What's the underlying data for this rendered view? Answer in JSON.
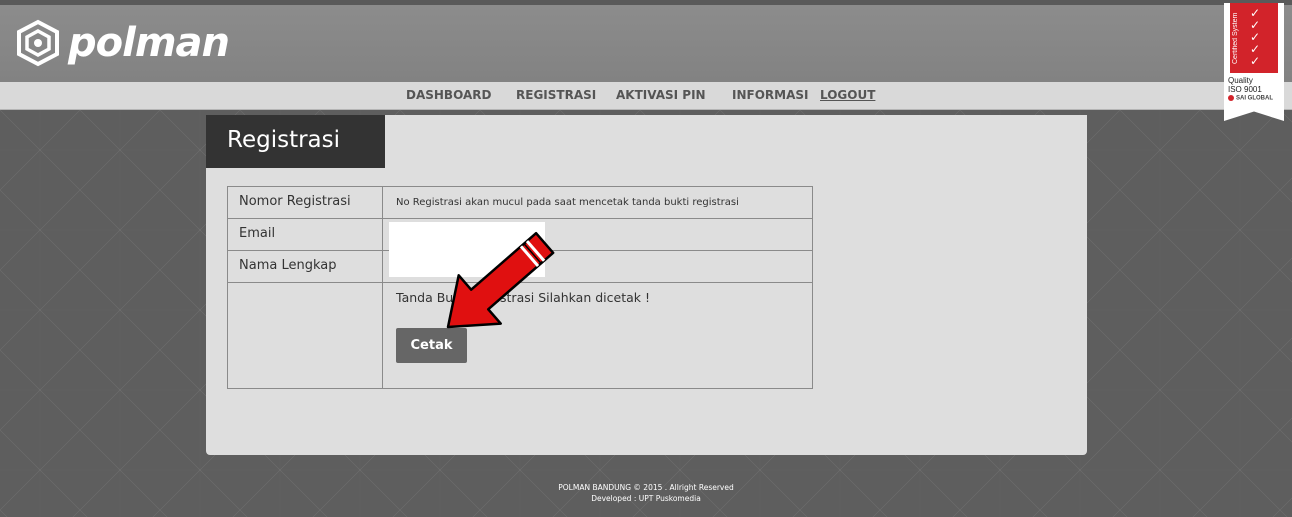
{
  "brand": {
    "logo_text": "polman",
    "logo_icon": "polman-hex-icon"
  },
  "nav": {
    "items": [
      {
        "label": "DASHBOARD"
      },
      {
        "label": "REGISTRASI"
      },
      {
        "label": "AKTIVASI PIN"
      },
      {
        "label": "INFORMASI"
      },
      {
        "label": "LOGOUT"
      }
    ]
  },
  "certification": {
    "vertical_text": "Certified System",
    "line1": "Quality",
    "line2": "ISO 9001",
    "line3": "SAI GLOBAL"
  },
  "page": {
    "title": "Registrasi"
  },
  "form": {
    "rows": [
      {
        "label": "Nomor Registrasi",
        "value": "No Registrasi akan mucul pada saat mencetak tanda bukti registrasi"
      },
      {
        "label": "Email",
        "value": ""
      },
      {
        "label": "Nama Lengkap",
        "value": ""
      },
      {
        "label": "",
        "value": ""
      }
    ],
    "message": "Tanda Bukti Registrasi Silahkan dicetak !",
    "print_button": "Cetak"
  },
  "footer": {
    "line1": "POLMAN BANDUNG © 2015 . Allright Reserved",
    "line2": "Developed : UPT Puskomedia"
  },
  "colors": {
    "header": "#8a8a8a",
    "navbar": "#d9d9d9",
    "panel": "#dedede",
    "title_bg": "#333333",
    "button": "#666666",
    "arrow": "#e01010",
    "cert_red": "#d2232a"
  }
}
